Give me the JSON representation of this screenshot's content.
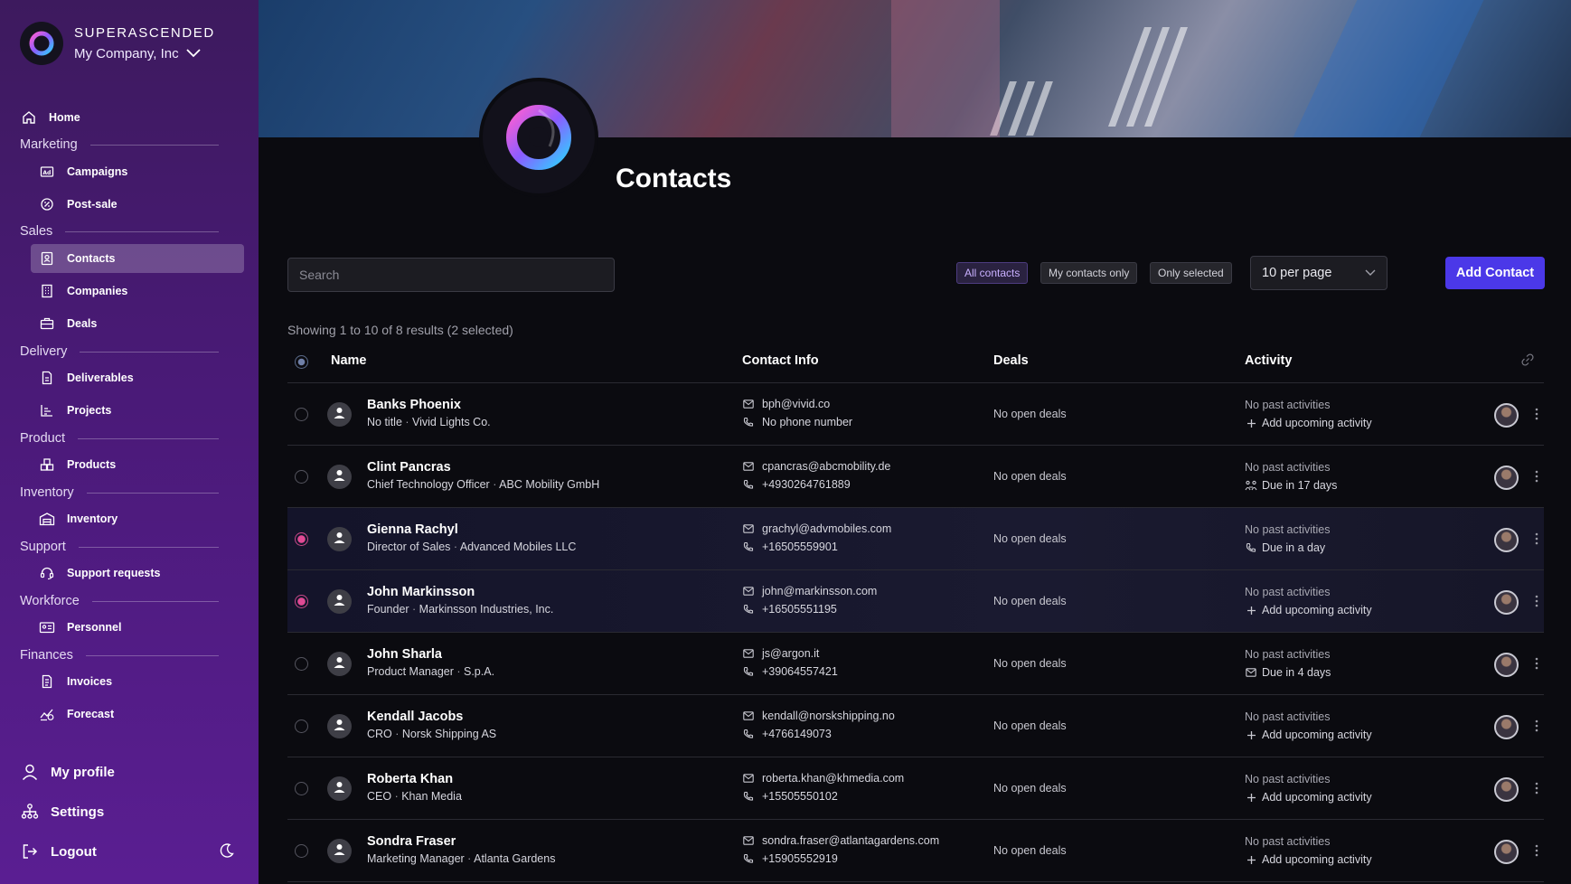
{
  "brand": {
    "name": "SUPERASCENDED",
    "company": "My Company, Inc"
  },
  "nav": {
    "home": "Home",
    "sections": {
      "marketing": "Marketing",
      "sales": "Sales",
      "delivery": "Delivery",
      "product": "Product",
      "inventory": "Inventory",
      "support": "Support",
      "workforce": "Workforce",
      "finances": "Finances"
    },
    "items": {
      "campaigns": "Campaigns",
      "post_sale": "Post-sale",
      "contacts": "Contacts",
      "companies": "Companies",
      "deals": "Deals",
      "deliverables": "Deliverables",
      "projects": "Projects",
      "products": "Products",
      "inventory": "Inventory",
      "support_requests": "Support requests",
      "personnel": "Personnel",
      "invoices": "Invoices",
      "forecast": "Forecast"
    },
    "bottom": {
      "profile": "My profile",
      "settings": "Settings",
      "logout": "Logout"
    }
  },
  "page": {
    "title": "Contacts"
  },
  "toolbar": {
    "search_placeholder": "Search",
    "filters": {
      "all": "All contacts",
      "mine": "My contacts only",
      "selected": "Only selected"
    },
    "per_page": "10 per page",
    "add_label": "Add Contact",
    "showing": "Showing 1 to 10 of 8 results (2 selected)"
  },
  "columns": {
    "name": "Name",
    "contact": "Contact Info",
    "deals": "Deals",
    "activity": "Activity"
  },
  "contacts": [
    {
      "name": "Banks Phoenix",
      "title": "No title",
      "company": "Vivid Lights Co.",
      "email": "bph@vivid.co",
      "phone": "No phone number",
      "deals": "No open deals",
      "past": "No past activities",
      "upcoming": "Add upcoming activity",
      "upcoming_icon": "plus-icon",
      "selected": false
    },
    {
      "name": "Clint Pancras",
      "title": "Chief Technology Officer",
      "company": "ABC Mobility GmbH",
      "email": "cpancras@abcmobility.de",
      "phone": "+4930264761889",
      "deals": "No open deals",
      "past": "No past activities",
      "upcoming": "Due in 17 days",
      "upcoming_icon": "meeting-icon",
      "selected": false
    },
    {
      "name": "Gienna Rachyl",
      "title": "Director of Sales",
      "company": "Advanced Mobiles LLC",
      "email": "grachyl@advmobiles.com",
      "phone": "+16505559901",
      "deals": "No open deals",
      "past": "No past activities",
      "upcoming": "Due in a day",
      "upcoming_icon": "phone-icon",
      "selected": true
    },
    {
      "name": "John Markinsson",
      "title": "Founder",
      "company": "Markinsson Industries, Inc.",
      "email": "john@markinsson.com",
      "phone": "+16505551195",
      "deals": "No open deals",
      "past": "No past activities",
      "upcoming": "Add upcoming activity",
      "upcoming_icon": "plus-icon",
      "selected": true
    },
    {
      "name": "John Sharla",
      "title": "Product Manager",
      "company": "S.p.A.",
      "email": "js@argon.it",
      "phone": "+39064557421",
      "deals": "No open deals",
      "past": "No past activities",
      "upcoming": "Due in 4 days",
      "upcoming_icon": "mail-icon",
      "selected": false
    },
    {
      "name": "Kendall Jacobs",
      "title": "CRO",
      "company": "Norsk Shipping AS",
      "email": "kendall@norskshipping.no",
      "phone": "+4766149073",
      "deals": "No open deals",
      "past": "No past activities",
      "upcoming": "Add upcoming activity",
      "upcoming_icon": "plus-icon",
      "selected": false
    },
    {
      "name": "Roberta Khan",
      "title": "CEO",
      "company": "Khan Media",
      "email": "roberta.khan@khmedia.com",
      "phone": "+15505550102",
      "deals": "No open deals",
      "past": "No past activities",
      "upcoming": "Add upcoming activity",
      "upcoming_icon": "plus-icon",
      "selected": false
    },
    {
      "name": "Sondra Fraser",
      "title": "Marketing Manager",
      "company": "Atlanta Gardens",
      "email": "sondra.fraser@atlantagardens.com",
      "phone": "+15905552919",
      "deals": "No open deals",
      "past": "No past activities",
      "upcoming": "Add upcoming activity",
      "upcoming_icon": "plus-icon",
      "selected": false
    }
  ],
  "colors": {
    "accent": "#4b38e8",
    "sidebar_top": "#3d1a5e",
    "sidebar_bottom": "#5a1e92",
    "selected_radio": "#e04a94"
  }
}
